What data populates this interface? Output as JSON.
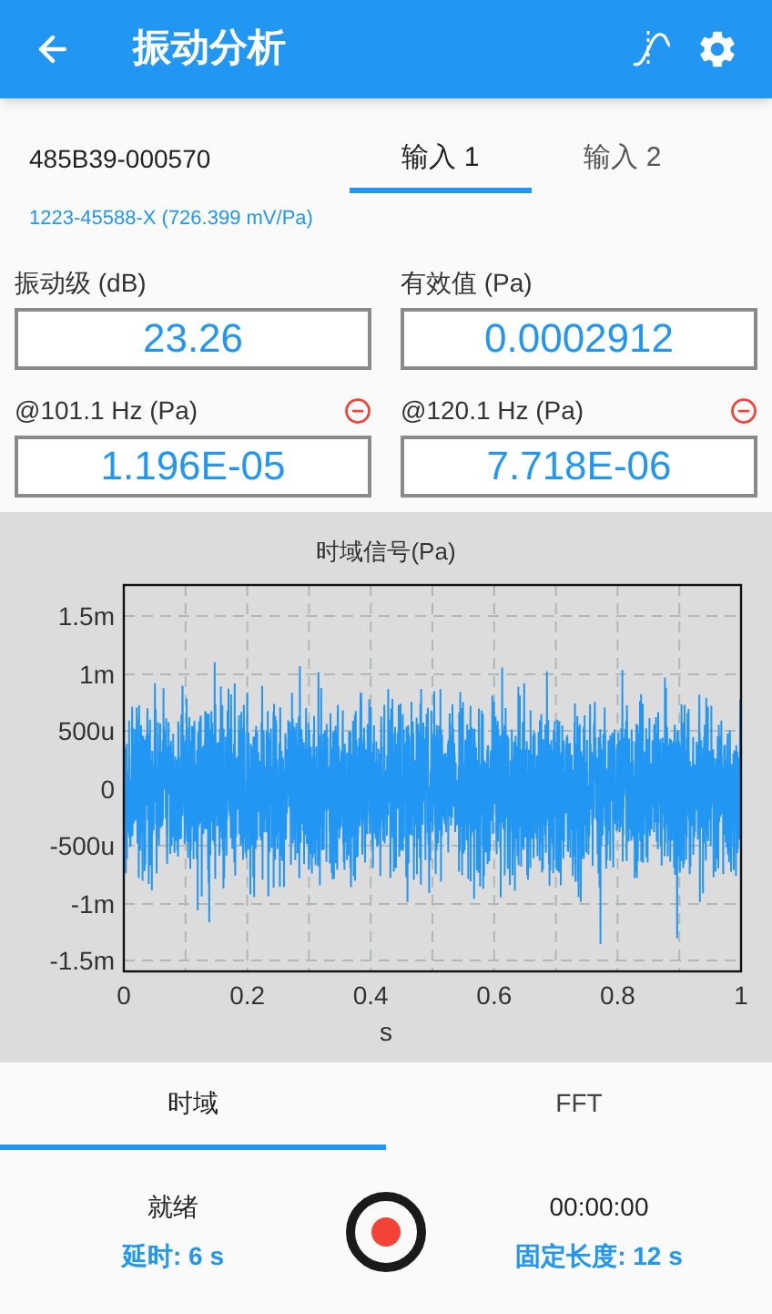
{
  "app_bar": {
    "title": "振动分析"
  },
  "sensor": {
    "serial": "485B39-000570",
    "calibration": "1223-45588-X (726.399 mV/Pa)"
  },
  "input_tabs": [
    {
      "label": "输入 1",
      "selected": true
    },
    {
      "label": "输入 2",
      "selected": false
    }
  ],
  "readings": [
    {
      "label": "振动级 (dB)",
      "value": "23.26",
      "removable": false
    },
    {
      "label": "有效值 (Pa)",
      "value": "0.0002912",
      "removable": false
    },
    {
      "label": "@101.1 Hz (Pa)",
      "value": "1.196E-05",
      "removable": true
    },
    {
      "label": "@120.1 Hz (Pa)",
      "value": "7.718E-06",
      "removable": true
    }
  ],
  "chart": {
    "title": "时域信号(Pa)",
    "xlabel": "s",
    "yticks": [
      "1.5m",
      "1m",
      "500u",
      "0",
      "-500u",
      "-1m",
      "-1.5m"
    ],
    "xticks": [
      "0",
      "0.2",
      "0.4",
      "0.6",
      "0.8",
      "1"
    ]
  },
  "view_tabs": [
    {
      "label": "时域",
      "selected": true
    },
    {
      "label": "FFT",
      "selected": false
    }
  ],
  "status": {
    "state": "就绪",
    "delay": "延时: 6 s",
    "elapsed": "00:00:00",
    "fixed_length": "固定长度: 12 s"
  }
}
